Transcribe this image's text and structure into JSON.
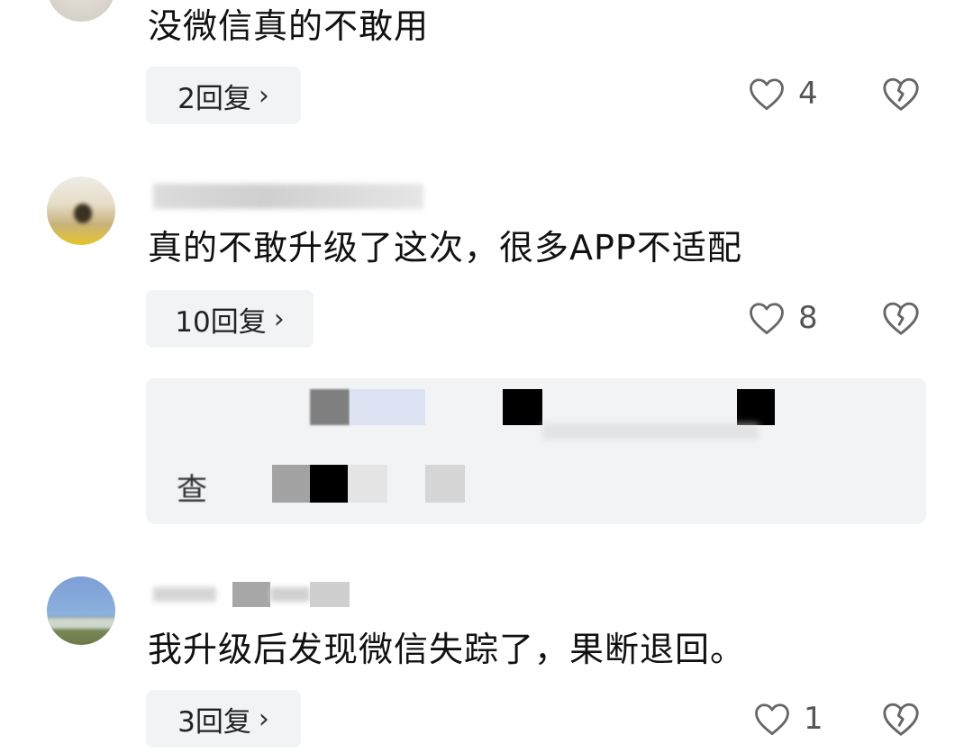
{
  "comments": [
    {
      "text": "没微信真的不敢用",
      "reply_label": "2回复",
      "like_count": "4",
      "icons": {
        "like": "heart-outline-icon",
        "dislike": "broken-heart-icon",
        "reply_chevron": "chevron-right-icon"
      }
    },
    {
      "text": "真的不敢升级了这次，很多APP不适配",
      "reply_label": "10回复",
      "like_count": "8",
      "quote_partial_char": "查",
      "icons": {
        "like": "heart-outline-icon",
        "dislike": "broken-heart-icon",
        "reply_chevron": "chevron-right-icon"
      }
    },
    {
      "text": "我升级后发现微信失踪了，果断退回。",
      "reply_label": "3回复",
      "like_count": "1",
      "icons": {
        "like": "heart-outline-icon",
        "dislike": "broken-heart-icon",
        "reply_chevron": "chevron-right-icon"
      }
    }
  ],
  "chevron_glyph": "›",
  "colors": {
    "reply_bg": "#f2f3f5",
    "text": "#111111",
    "count": "#555555",
    "icon": "#666666"
  }
}
